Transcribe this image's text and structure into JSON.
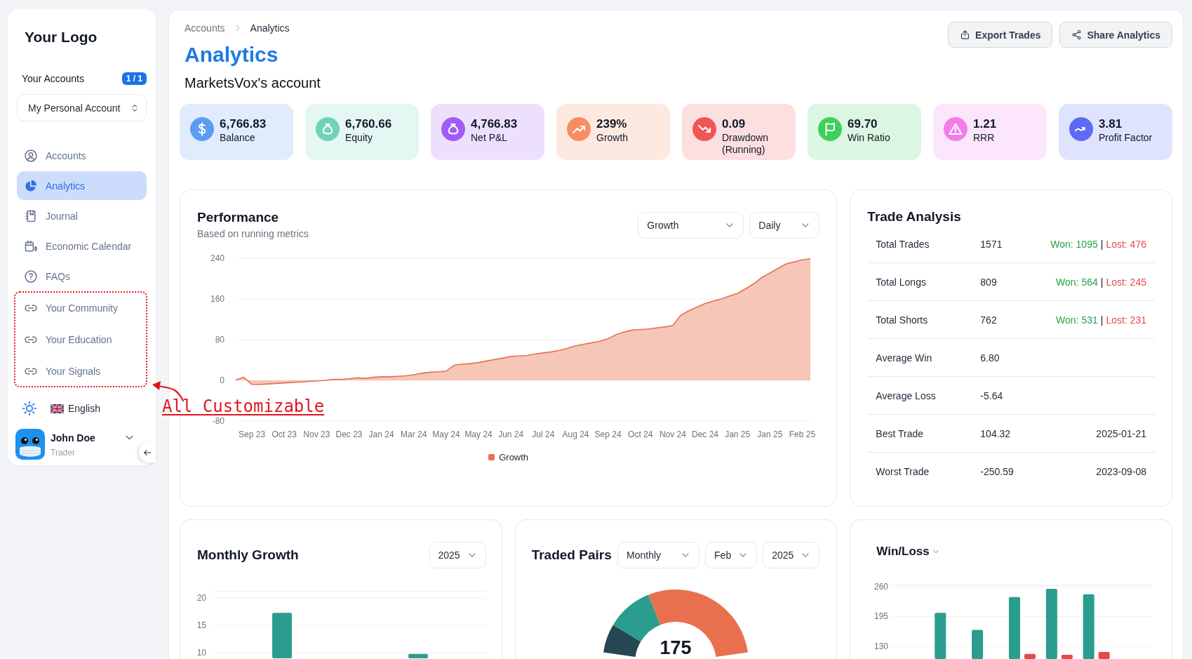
{
  "sidebar": {
    "logo": "Your Logo",
    "accounts_label": "Your Accounts",
    "accounts_count": "1 / 1",
    "account_select": {
      "value": "My Personal Account"
    },
    "nav": [
      {
        "label": "Accounts",
        "selected": false
      },
      {
        "label": "Analytics",
        "selected": true
      },
      {
        "label": "Journal",
        "selected": false
      },
      {
        "label": "Economic Calendar",
        "selected": false
      },
      {
        "label": "FAQs",
        "selected": false
      }
    ],
    "custom_links": [
      {
        "label": "Your Community",
        "selected": false
      },
      {
        "label": "Your Education",
        "selected": false
      },
      {
        "label": "Your Signals",
        "selected": false
      }
    ],
    "language": "English",
    "user": {
      "name": "John Doe",
      "role": "Trader"
    }
  },
  "annotation": {
    "text": "All Customizable"
  },
  "header": {
    "breadcrumb": [
      {
        "label": "Accounts"
      },
      {
        "label": "Analytics"
      }
    ],
    "title": "Analytics",
    "subtitle": "MarketsVox's account",
    "buttons": [
      {
        "label": "Export Trades"
      },
      {
        "label": "Share Analytics"
      }
    ]
  },
  "stats": [
    {
      "value": "6,766.83",
      "label": "Balance",
      "color": "#5d9cf5"
    },
    {
      "value": "6,760.66",
      "label": "Equity",
      "color": "#6fd3b8"
    },
    {
      "value": "4,766.83",
      "label": "Net P&L",
      "color": "#a25cf6"
    },
    {
      "value": "239%",
      "label": "Growth",
      "color": "#f88d62"
    },
    {
      "value": "0.09",
      "label": "Drawdown (Running)",
      "color": "#ef5656"
    },
    {
      "value": "69.70",
      "label": "Win Ratio",
      "color": "#3fcf5f"
    },
    {
      "value": "1.21",
      "label": "RRR",
      "color": "#f07de9"
    },
    {
      "value": "3.81",
      "label": "Profit Factor",
      "color": "#5c6af5"
    }
  ],
  "performance": {
    "title": "Performance",
    "subtitle": "Based on running metrics",
    "filters": [
      {
        "value": "Growth"
      },
      {
        "value": "Daily"
      }
    ],
    "chart_data": {
      "type": "area",
      "categories": [
        null,
        null,
        "Sep 23",
        null,
        null,
        null,
        "Oct 23",
        null,
        null,
        null,
        "Nov 23",
        null,
        null,
        null,
        "Dec 23",
        null,
        null,
        null,
        "Jan 24",
        null,
        null,
        null,
        "Mar 24",
        null,
        null,
        null,
        "May 24",
        null,
        null,
        null,
        "May 24",
        null,
        null,
        null,
        "Jun 24",
        null,
        null,
        null,
        "Jul 24",
        null,
        null,
        null,
        "Aug 24",
        null,
        null,
        null,
        "Sep 24",
        null,
        null,
        null,
        "Oct 24",
        null,
        null,
        null,
        "Nov 24",
        null,
        null,
        null,
        "Dec 24",
        null,
        null,
        null,
        "Jan 25",
        null,
        null,
        null,
        "Jan 25",
        null,
        null,
        null,
        "Feb 25",
        null
      ],
      "series": [
        {
          "name": "Growth",
          "color": "#e8704f",
          "values": [
            1,
            6,
            -8,
            -8,
            -7,
            -6,
            -5,
            -4,
            -3,
            -2,
            -1,
            0,
            2,
            2,
            3,
            5,
            4,
            6,
            7,
            7,
            8,
            9,
            11,
            14,
            16,
            17,
            18,
            30,
            32,
            33,
            35,
            38,
            41,
            44,
            47,
            48,
            49,
            52,
            54,
            56,
            59,
            63,
            68,
            71,
            74,
            77,
            82,
            90,
            95,
            99,
            100,
            101,
            103,
            105,
            108,
            128,
            137,
            144,
            151,
            156,
            160,
            166,
            171,
            180,
            190,
            202,
            211,
            220,
            229,
            233,
            237,
            239
          ]
        }
      ],
      "ylim": [
        -80,
        240
      ],
      "yticks": [
        -80,
        0,
        80,
        160,
        240
      ],
      "grid": true
    }
  },
  "trade_analysis": {
    "title": "Trade Analysis",
    "rows": [
      {
        "label": "Total Trades",
        "value": "1571",
        "won": "Won: 1095",
        "separator": "|",
        "lost": "Lost: 476"
      },
      {
        "label": "Total Longs",
        "value": "809",
        "won": "Won: 564",
        "separator": "|",
        "lost": "Lost: 245"
      },
      {
        "label": "Total Shorts",
        "value": "762",
        "won": "Won: 531",
        "separator": "|",
        "lost": "Lost: 231"
      },
      {
        "label": "Average Win",
        "value": "6.80"
      },
      {
        "label": "Average Loss",
        "value": "-5.64"
      },
      {
        "label": "Best Trade",
        "value": "104.32",
        "date": "2025-01-21"
      },
      {
        "label": "Worst Trade",
        "value": "-250.59",
        "date": "2023-09-08"
      }
    ]
  },
  "monthly_growth": {
    "title": "Monthly Growth",
    "filters": [
      {
        "value": "2025"
      }
    ],
    "chart_data": {
      "type": "bar",
      "categories": [
        null,
        null
      ],
      "ylim": [
        9,
        21.3
      ],
      "yticks": [
        10,
        15,
        20
      ],
      "grid": true,
      "stacked": false,
      "series": [
        {
          "color": "#2a9d8f",
          "values": [
            17.3,
            9.8
          ]
        }
      ]
    }
  },
  "traded_pairs": {
    "title": "Traded Pairs",
    "filters": [
      {
        "value": "Monthly"
      },
      {
        "value": "Feb"
      },
      {
        "value": "2025"
      }
    ],
    "total": "175"
  },
  "win_loss": {
    "title": "Win/Loss",
    "chart_data": {
      "type": "bar",
      "categories": [
        null,
        null,
        null,
        null,
        null,
        null,
        null
      ],
      "ylim": [
        103,
        264
      ],
      "yticks": [
        130,
        195,
        260
      ],
      "grid": true,
      "stacked": false,
      "series": [
        {
          "color": "#2a9d8f",
          "values": [
            null,
            203,
            166,
            237,
            255,
            243,
            null
          ]
        },
        {
          "color": "#e4484b",
          "values": [
            null,
            null,
            null,
            114,
            112,
            118,
            null
          ]
        }
      ]
    }
  }
}
